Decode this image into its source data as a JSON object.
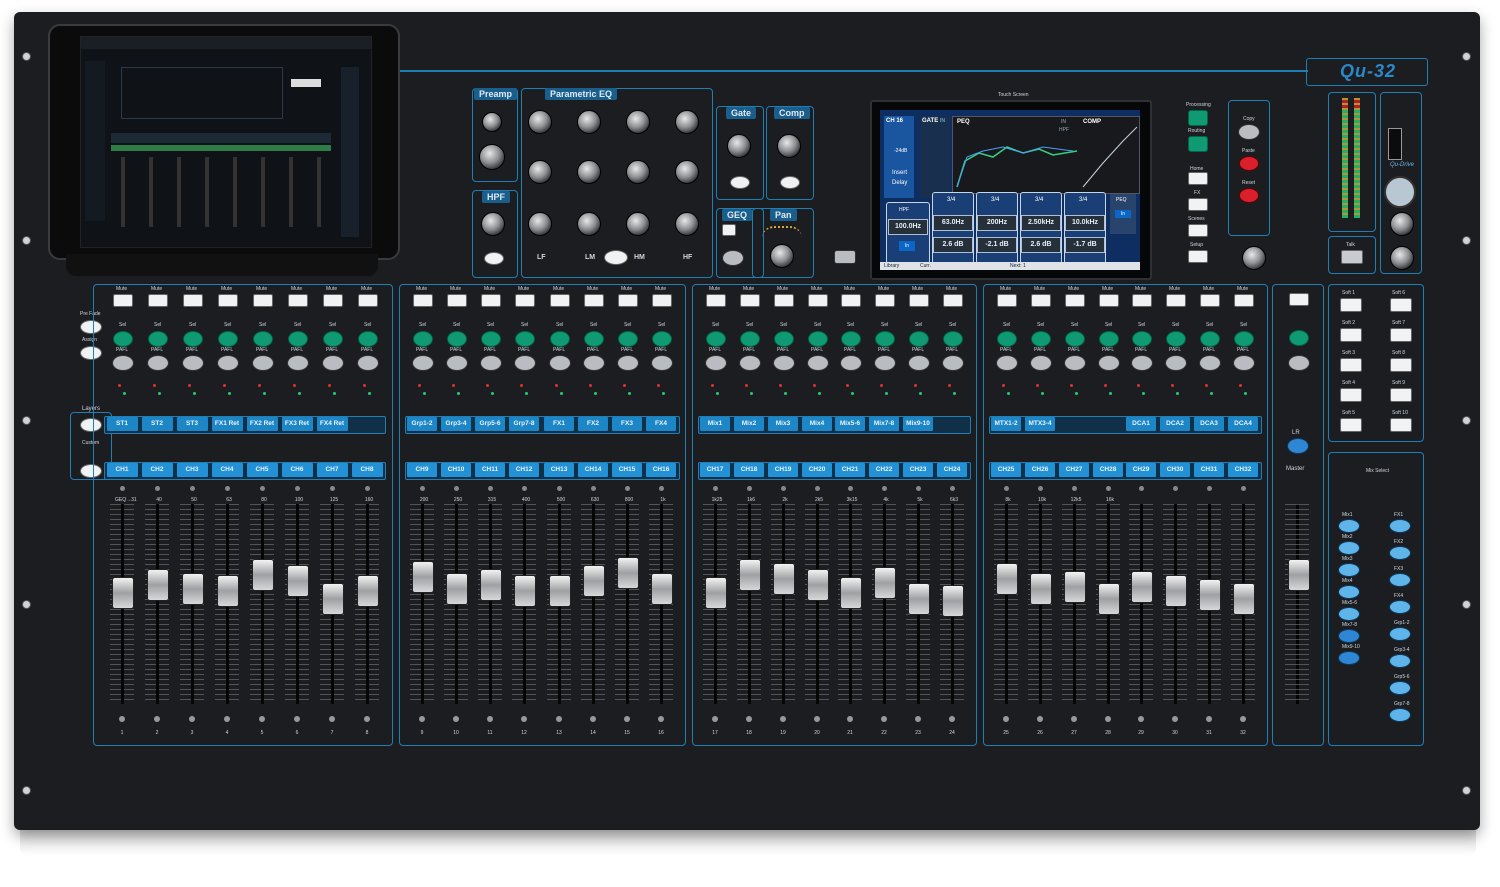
{
  "brand": {
    "model": "Qu-32",
    "usb_logo": "Qu-Drive"
  },
  "top_sections": {
    "preamp": "Preamp",
    "parametric_eq": "Parametric EQ",
    "gate": "Gate",
    "comp": "Comp",
    "hpf": "HPF",
    "geq": "GEQ",
    "pan": "Pan",
    "touch_screen": "Touch Screen"
  },
  "eq_labels": {
    "lf": "LF",
    "lm": "LM",
    "hm": "HM",
    "hf": "HF"
  },
  "touch_screen": {
    "channel": "CH 16",
    "gate": "GATE",
    "gate_in": "IN",
    "peq": "PEQ",
    "hpf_in": "IN",
    "hpf": "HPF",
    "comp": "COMP",
    "insert": "Insert",
    "delay": "Delay",
    "gain": "-24dB",
    "hpf_label": "HPF",
    "hpf_freq": "100.0Hz",
    "hpf_in_btn": "In",
    "band_title": "3/4",
    "peq_label": "PEQ",
    "peq_in": "In",
    "freqs": [
      "63.0Hz",
      "200Hz",
      "2.50kHz",
      "10.0kHz"
    ],
    "gains": [
      "2.6 dB",
      "-2.1 dB",
      "2.6 dB",
      "-1.7 dB"
    ],
    "library": "Library",
    "current": "Curr.",
    "next": "Next: 1"
  },
  "right_panel": {
    "processing": "Processing",
    "routing": "Routing",
    "home": "Home",
    "fx": "FX",
    "scenes": "Scenes",
    "setup": "Setup",
    "copy": "Copy",
    "paste": "Paste",
    "reset": "Reset",
    "talk": "Talk",
    "lr": "LR",
    "master": "Master",
    "mix_select": "Mix Select",
    "softkeys": [
      "Soft 1",
      "Soft 6",
      "Soft 2",
      "Soft 7",
      "Soft 3",
      "Soft 8",
      "Soft 4",
      "Soft 9",
      "Soft 5",
      "Soft 10"
    ],
    "mix_select_left": [
      "Mix1",
      "Mix2",
      "Mix3",
      "Mix4",
      "Mix5-6",
      "Mix7-8",
      "Mix9-10"
    ],
    "mix_select_right": [
      "FX1",
      "FX2",
      "FX3",
      "FX4",
      "Grp1-2",
      "Grp3-4",
      "Grp5-6",
      "Grp7-8"
    ]
  },
  "left_panel": {
    "pre_fade": "Pre Fade",
    "assign": "Assign",
    "layers": "Layers",
    "custom": "Custom"
  },
  "strip_labels": {
    "mute": "Mute",
    "sel": "Sel",
    "pafl": "PAFL"
  },
  "layer_top": [
    "ST1",
    "ST2",
    "ST3",
    "FX1 Ret",
    "FX2 Ret",
    "FX3 Ret",
    "FX4 Ret",
    "",
    "Grp1-2",
    "Grp3-4",
    "Grp5-6",
    "Grp7-8",
    "FX1",
    "FX2",
    "FX3",
    "FX4",
    "Mix1",
    "Mix2",
    "Mix3",
    "Mix4",
    "Mix5-6",
    "Mix7-8",
    "Mix9-10",
    "",
    "MTX1-2",
    "MTX3-4",
    "",
    "",
    "DCA1",
    "DCA2",
    "DCA3",
    "DCA4"
  ],
  "layer_bottom": [
    "CH1",
    "CH2",
    "CH3",
    "CH4",
    "CH5",
    "CH6",
    "CH7",
    "CH8",
    "CH9",
    "CH10",
    "CH11",
    "CH12",
    "CH13",
    "CH14",
    "CH15",
    "CH16",
    "CH17",
    "CH18",
    "CH19",
    "CH20",
    "CH21",
    "CH22",
    "CH23",
    "CH24",
    "CH25",
    "CH26",
    "CH27",
    "CH28",
    "CH29",
    "CH30",
    "CH31",
    "CH32"
  ],
  "geq_freqs": [
    "GEQ→31",
    "40",
    "50",
    "63",
    "80",
    "100",
    "125",
    "160",
    "200",
    "250",
    "315",
    "400",
    "500",
    "630",
    "800",
    "1k",
    "1k25",
    "1k6",
    "2k",
    "2k5",
    "3k15",
    "4k",
    "5k",
    "6k3",
    "8k",
    "10k",
    "12k5",
    "16k"
  ],
  "strip_numbers": [
    "1",
    "2",
    "3",
    "4",
    "5",
    "6",
    "7",
    "8",
    "9",
    "10",
    "11",
    "12",
    "13",
    "14",
    "15",
    "16",
    "17",
    "18",
    "19",
    "20",
    "21",
    "22",
    "23",
    "24",
    "25",
    "26",
    "27",
    "28",
    "29",
    "30",
    "31",
    "32"
  ],
  "fader_levels": [
    0.36,
    0.4,
    0.38,
    0.37,
    0.45,
    0.42,
    0.33,
    0.37,
    0.44,
    0.38,
    0.4,
    0.37,
    0.37,
    0.42,
    0.46,
    0.38,
    0.36,
    0.45,
    0.43,
    0.4,
    0.36,
    0.41,
    0.33,
    0.32,
    0.43,
    0.38,
    0.39,
    0.33,
    0.39,
    0.37,
    0.35,
    0.33
  ],
  "master_fader_level": 0.45
}
